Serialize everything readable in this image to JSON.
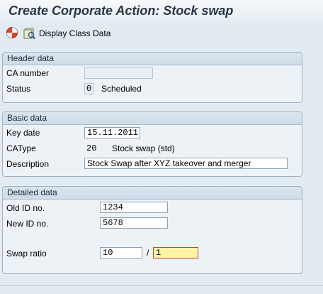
{
  "window": {
    "title": "Create Corporate Action: Stock swap"
  },
  "toolbar": {
    "execute_icon": "execute-icon",
    "class_data_label": "Display Class Data"
  },
  "header_data": {
    "title": "Header data",
    "ca_number_label": "CA number",
    "ca_number_value": "",
    "status_label": "Status",
    "status_code": "0",
    "status_text": "Scheduled"
  },
  "basic_data": {
    "title": "Basic data",
    "key_date_label": "Key date",
    "key_date_value": "15.11.2011",
    "ca_type_label": "CAType",
    "ca_type_code": "20",
    "ca_type_text": "Stock swap (std)",
    "description_label": "Description",
    "description_value": "Stock Swap after XYZ takeover and merger"
  },
  "detailed_data": {
    "title": "Detailed data",
    "old_id_label": "Old ID no.",
    "old_id_value": "1234",
    "new_id_label": "New ID no.",
    "new_id_value": "5678",
    "swap_ratio_label": "Swap ratio",
    "swap_ratio_left": "10",
    "swap_ratio_separator": "/",
    "swap_ratio_right": "1"
  },
  "colors": {
    "background": "#e3ebf2",
    "title_text": "#253646",
    "focused_field": "#fdf2a6",
    "focus_border": "#c24b2b"
  }
}
